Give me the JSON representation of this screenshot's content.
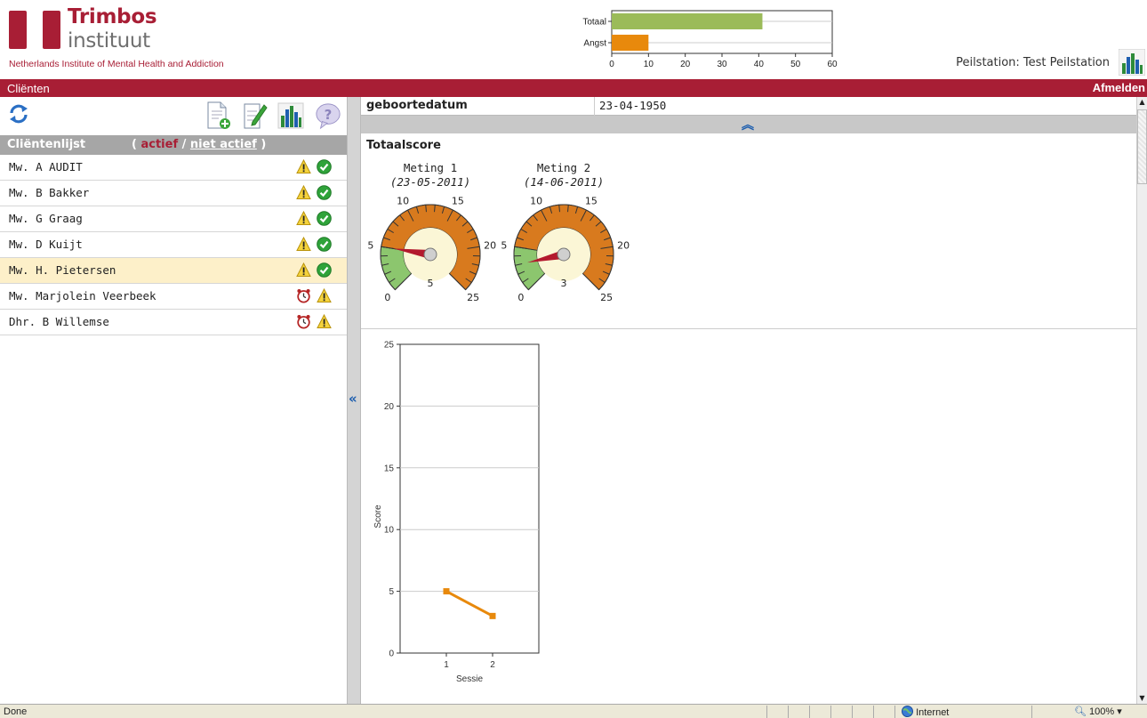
{
  "header": {
    "logo_name_line1": "Trimbos",
    "logo_name_line2": "instituut",
    "logo_subtitle": "Netherlands Institute of Mental Health and Addiction",
    "station_label": "Peilstation: Test Peilstation",
    "brand_color": "#a81e35"
  },
  "mini_chart": {
    "type": "bar",
    "orientation": "horizontal",
    "categories": [
      "Totaal",
      "Angst"
    ],
    "values": [
      41,
      10
    ],
    "colors": [
      "#9bbb59",
      "#e8890c"
    ],
    "xlim": [
      0,
      60
    ],
    "xticks": [
      "0",
      "10",
      "20",
      "30",
      "40",
      "50",
      "60"
    ]
  },
  "nav": {
    "tab_clients": "Cliënten",
    "logout": "Afmelden"
  },
  "toolbar": {
    "icons": [
      "refresh-icon",
      "new-document-icon",
      "edit-document-icon",
      "bar-chart-icon",
      "help-icon"
    ]
  },
  "client_list": {
    "title": "Cliëntenlijst",
    "filter_open": "(",
    "filter_active": "actief",
    "filter_sep": "/",
    "filter_inactive": "niet actief",
    "filter_close": ")",
    "rows": [
      {
        "name": "Mw. A AUDIT",
        "icons": [
          "warning-icon",
          "check-icon"
        ],
        "selected": false
      },
      {
        "name": "Mw. B Bakker",
        "icons": [
          "warning-icon",
          "check-icon"
        ],
        "selected": false
      },
      {
        "name": "Mw. G Graag",
        "icons": [
          "warning-icon",
          "check-icon"
        ],
        "selected": false
      },
      {
        "name": "Mw. D Kuijt",
        "icons": [
          "warning-icon",
          "check-icon"
        ],
        "selected": false
      },
      {
        "name": "Mw. H. Pietersen",
        "icons": [
          "warning-icon",
          "check-icon"
        ],
        "selected": true
      },
      {
        "name": "Mw. Marjolein Veerbeek",
        "icons": [
          "alarm-clock-icon",
          "warning-icon"
        ],
        "selected": false
      },
      {
        "name": "Dhr. B Willemse",
        "icons": [
          "alarm-clock-icon",
          "warning-icon"
        ],
        "selected": false
      }
    ]
  },
  "detail": {
    "dob_label": "geboortedatum",
    "dob_value": "23-04-1950",
    "total_title": "Totaalscore",
    "gauges": [
      {
        "label": "Meting 1",
        "date": "(23-05-2011)",
        "value": 5,
        "value_label": "5"
      },
      {
        "label": "Meting 2",
        "date": "(14-06-2011)",
        "value": 3,
        "value_label": "3"
      }
    ],
    "gauge_scale": {
      "min": 0,
      "max": 25,
      "tick_labels": [
        "0",
        "5",
        "10",
        "15",
        "20",
        "25"
      ]
    }
  },
  "chart_data": {
    "type": "line",
    "x": [
      1,
      2
    ],
    "series": [
      {
        "values": [
          5,
          3
        ],
        "color": "#e8890c"
      }
    ],
    "xlabel": "Sessie",
    "ylabel": "Score",
    "ylim": [
      0,
      25
    ],
    "yticks": [
      0,
      5,
      10,
      15,
      20,
      25
    ],
    "xticks": [
      1,
      2
    ],
    "grid": true
  },
  "statusbar": {
    "status": "Done",
    "zone": "Internet",
    "zoom": "100%"
  }
}
